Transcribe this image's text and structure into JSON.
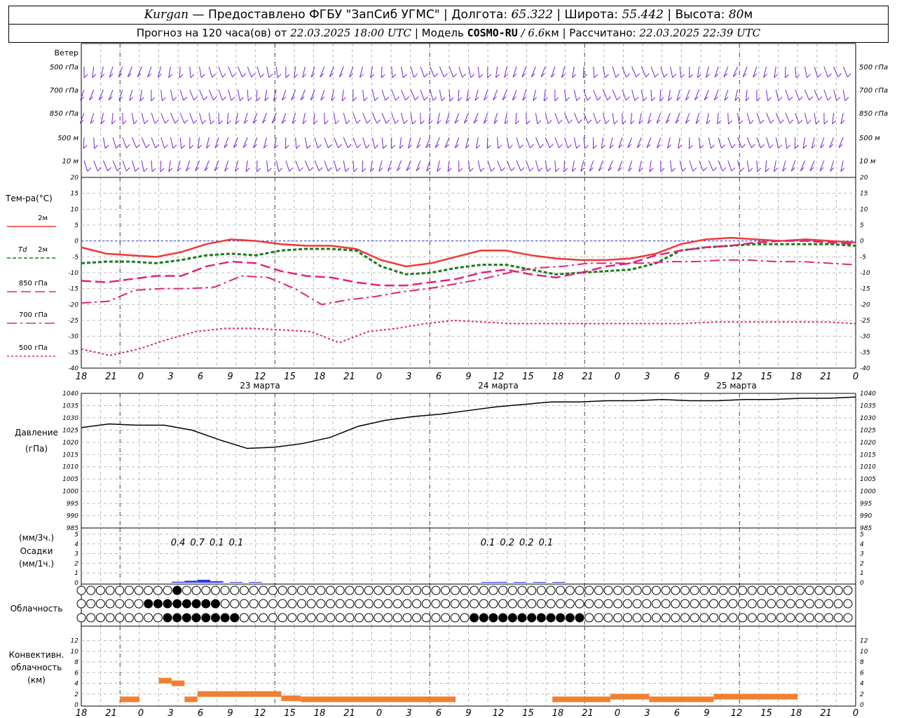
{
  "header": {
    "place": "Kurgan",
    "provider": "— Предоставлено ФГБУ \"ЗапСиб УГМС\" |",
    "lon_label": "Долгота:",
    "lon_value": "65.322",
    "lat_label": "| Широта:",
    "lat_value": "55.442",
    "alt_label": "| Высота:",
    "alt_value": "80",
    "alt_unit": "м",
    "forecast_prefix": "Прогноз на 120 часа(ов) от",
    "forecast_date": "22.03.2025 18:00 UTC",
    "model_label": "| Модель",
    "model_name": "COSMO-RU",
    "model_res": "/ 6.6",
    "model_res_unit": "км",
    "calc_label": "| Рассчитано:",
    "calc_date": "22.03.2025 22:39 UTC"
  },
  "axis": {
    "hour_labels": [
      "18",
      "21",
      "0",
      "3",
      "6",
      "9",
      "12",
      "15",
      "18",
      "21",
      "0",
      "3",
      "6",
      "9",
      "12",
      "15",
      "18",
      "21",
      "0",
      "3",
      "6",
      "9",
      "12",
      "15",
      "18",
      "21",
      "0"
    ],
    "day_labels": [
      "23 марта",
      "24 марта",
      "25 марта"
    ]
  },
  "colors": {
    "purple": "#7a22d8",
    "red": "#f03838",
    "green": "#1a7a1a",
    "magenta": "#e0247c",
    "pink": "#e0247c",
    "blue": "#2a38e0",
    "orange": "#f08030"
  },
  "wind": {
    "title": "Ветер",
    "levels": [
      "500 гПа",
      "700 гПа",
      "850 гПа",
      "500 м",
      "10 м"
    ]
  },
  "temperature": {
    "title": "Тем-ра(°C)",
    "legend": [
      {
        "label": "2м",
        "prefix": ""
      },
      {
        "label": "2м",
        "prefix": "Td"
      },
      {
        "label": "850 гПа",
        "prefix": ""
      },
      {
        "label": "700 гПа",
        "prefix": ""
      },
      {
        "label": "500 гПа",
        "prefix": ""
      }
    ],
    "ticks": [
      "20",
      "15",
      "10",
      "5",
      "0",
      "-5",
      "-10",
      "-15",
      "-20",
      "-25",
      "-30",
      "-35",
      "-40"
    ]
  },
  "pressure": {
    "title": "Давление",
    "unit": "(гПа)",
    "ticks": [
      "1040",
      "1035",
      "1030",
      "1025",
      "1020",
      "1015",
      "1010",
      "1005",
      "1000",
      "995",
      "990",
      "985"
    ]
  },
  "precip": {
    "unit_3h": "(мм/3ч.)",
    "title": "Осадки",
    "unit_1h": "(мм/1ч.)",
    "ticks": [
      "5",
      "4",
      "3",
      "2",
      "1",
      "0"
    ],
    "totals": [
      {
        "hour": 15,
        "text": "0.4"
      },
      {
        "hour": 18,
        "text": "0.7"
      },
      {
        "hour": 21,
        "text": "0.1"
      },
      {
        "hour": 24,
        "text": "0.1"
      },
      {
        "hour": 63,
        "text": "0.1"
      },
      {
        "hour": 66,
        "text": "0.2"
      },
      {
        "hour": 69,
        "text": "0.2"
      },
      {
        "hour": 72,
        "text": "0.1"
      }
    ]
  },
  "cloud": {
    "title": "Облачность"
  },
  "convective": {
    "title1": "Конвективн.",
    "title2": "облачность",
    "unit": "(км)",
    "ticks": [
      "12",
      "10",
      "8",
      "6",
      "4",
      "2",
      "0"
    ]
  },
  "chart_data": {
    "type": "line",
    "x_hours": [
      0,
      3,
      6,
      9,
      12,
      15,
      18,
      21,
      24,
      27,
      30,
      33,
      36,
      39,
      42,
      45,
      48,
      51,
      54,
      57,
      60,
      63,
      66,
      69,
      72,
      75,
      78,
      81,
      84,
      87,
      90,
      93,
      96,
      99,
      102,
      105,
      108,
      111,
      114,
      117,
      120
    ],
    "series": [
      {
        "name": "2м",
        "values": [
          -2,
          -4,
          -4.5,
          -5,
          -3.5,
          -1,
          0.5,
          0,
          -1,
          -1.5,
          -1.5,
          -2.5,
          -6,
          -8,
          -7,
          -5,
          -3,
          -3,
          -4.5,
          -5.5,
          -6,
          -6,
          -5.5,
          -4,
          -1,
          0.5,
          1,
          0.5,
          0,
          0.5,
          0,
          -0.5
        ]
      },
      {
        "name": "Td 2м",
        "values": [
          -7,
          -6.5,
          -6.5,
          -7,
          -6,
          -4.5,
          -4,
          -4.5,
          -3,
          -2.5,
          -2.5,
          -3,
          -8,
          -10.5,
          -10,
          -8.5,
          -7.5,
          -7.5,
          -9,
          -10.5,
          -10,
          -9.5,
          -9,
          -7,
          -3,
          -2,
          -1.5,
          -1,
          -1,
          -1,
          -1,
          -1.5
        ]
      },
      {
        "name": "850 гПа",
        "values": [
          -12.5,
          -13,
          -12,
          -11,
          -11,
          -8,
          -6.5,
          -7,
          -9.5,
          -11,
          -11.5,
          -13,
          -14,
          -14,
          -13,
          -12,
          -10,
          -9,
          -10.5,
          -11.5,
          -10,
          -8,
          -7,
          -4.5,
          -3,
          -2,
          -1.5,
          -0.5,
          0,
          0,
          -0.5,
          -1
        ]
      },
      {
        "name": "700 гПа",
        "values": [
          -19.5,
          -19,
          -15.5,
          -15,
          -15,
          -14.5,
          -11,
          -11.5,
          -15,
          -20,
          -18.5,
          -17.5,
          -16,
          -15,
          -13.5,
          -12,
          -10,
          -8.5,
          -8,
          -7,
          -7,
          -7,
          -6.5,
          -6.5,
          -6,
          -6,
          -6.5,
          -6.5,
          -7,
          -7.5
        ]
      },
      {
        "name": "500 гПа",
        "values": [
          -34,
          -36,
          -34,
          -31,
          -28.5,
          -27.5,
          -27.5,
          -28,
          -28.5,
          -32,
          -28.5,
          -27.5,
          -26,
          -25,
          -25.5,
          -26,
          -26,
          -26,
          -26,
          -26,
          -26,
          -26,
          -25.5,
          -25.5,
          -25.5,
          -25.5,
          -25.5,
          -26
        ]
      }
    ],
    "pressure_hpa": [
      1026,
      1027.5,
      1027,
      1027,
      1025,
      1021,
      1017.5,
      1018,
      1019.5,
      1022,
      1026.5,
      1029,
      1030.5,
      1031.5,
      1033,
      1034.5,
      1035.5,
      1036.5,
      1036.5,
      1037,
      1037,
      1037.5,
      1037,
      1037,
      1037.5,
      1037.5,
      1038,
      1038,
      1038.5
    ],
    "precip_mm": [
      {
        "x": 14,
        "v": 0.1
      },
      {
        "x": 16,
        "v": 0.2
      },
      {
        "x": 18,
        "v": 0.3
      },
      {
        "x": 20,
        "v": 0.15
      },
      {
        "x": 23,
        "v": 0.05
      },
      {
        "x": 26,
        "v": 0.04
      },
      {
        "x": 62,
        "v": 0.04
      },
      {
        "x": 64,
        "v": 0.08
      },
      {
        "x": 67,
        "v": 0.06
      },
      {
        "x": 70,
        "v": 0.06
      },
      {
        "x": 73,
        "v": 0.05
      }
    ],
    "convective_km": [
      {
        "x0": 6,
        "x1": 9,
        "v": 1
      },
      {
        "x0": 12,
        "x1": 14,
        "v": 4.5
      },
      {
        "x0": 14,
        "x1": 16,
        "v": 4
      },
      {
        "x0": 16,
        "x1": 18,
        "v": 1
      },
      {
        "x0": 18,
        "x1": 22,
        "v": 2
      },
      {
        "x0": 22,
        "x1": 31,
        "v": 2
      },
      {
        "x0": 31,
        "x1": 34,
        "v": 1.2
      },
      {
        "x0": 34,
        "x1": 55,
        "v": 1
      },
      {
        "x0": 55,
        "x1": 58,
        "v": 1
      },
      {
        "x0": 73,
        "x1": 82,
        "v": 1
      },
      {
        "x0": 82,
        "x1": 88,
        "v": 1.5
      },
      {
        "x0": 88,
        "x1": 94,
        "v": 1
      },
      {
        "x0": 94,
        "x1": 98,
        "v": 1
      },
      {
        "x0": 98,
        "x1": 105,
        "v": 1.5
      },
      {
        "x0": 105,
        "x1": 111,
        "v": 1.5
      }
    ],
    "ylim_temp": [
      -40,
      20
    ],
    "ylim_pressure": [
      985,
      1040
    ],
    "ylim_precip": [
      0,
      5
    ],
    "ylim_conv": [
      0,
      13
    ]
  }
}
